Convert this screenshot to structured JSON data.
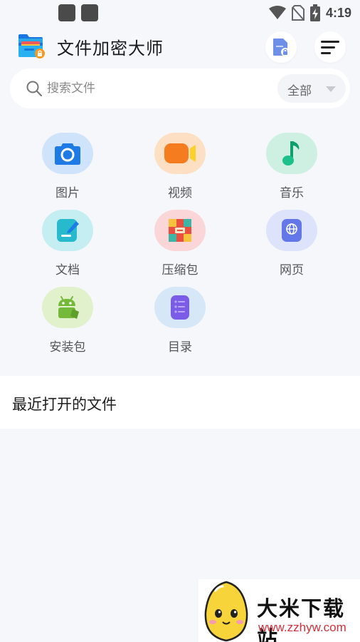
{
  "status_bar": {
    "time": "4:19",
    "icons": [
      "app-notification-icon",
      "app-notification-icon",
      "wifi-icon",
      "no-sim-icon",
      "battery-charging-icon"
    ]
  },
  "header": {
    "title": "文件加密大师",
    "logo_icon": "folder-lock-icon",
    "actions": [
      "lock-file-icon",
      "menu-icon"
    ]
  },
  "search": {
    "placeholder": "搜索文件",
    "filter_label": "全部"
  },
  "categories": [
    {
      "label": "图片",
      "icon": "camera-icon",
      "bg": "#cfe3fb",
      "accent": "#1e7be6"
    },
    {
      "label": "视频",
      "icon": "video-icon",
      "bg": "#fde0c4",
      "accent": "#f57c1f"
    },
    {
      "label": "音乐",
      "icon": "music-note-icon",
      "bg": "#cdf0e2",
      "accent": "#1cc08a"
    },
    {
      "label": "文档",
      "icon": "document-icon",
      "bg": "#c4eef2",
      "accent": "#27b9cc"
    },
    {
      "label": "压缩包",
      "icon": "archive-icon",
      "bg": "#fbd6d8",
      "accent": "#e9503f"
    },
    {
      "label": "网页",
      "icon": "web-icon",
      "bg": "#dde3fb",
      "accent": "#6477e8"
    },
    {
      "label": "安装包",
      "icon": "android-icon",
      "bg": "#e0f1cc",
      "accent": "#75b93b"
    },
    {
      "label": "目录",
      "icon": "directory-icon",
      "bg": "#d6e7f8",
      "accent": "#7a5ce6"
    }
  ],
  "recent": {
    "title": "最近打开的文件"
  },
  "watermark": {
    "title": "大米下载站",
    "url": "www.zzhyw.com"
  },
  "colors": {
    "background": "#f6f7fb",
    "surface": "#ffffff",
    "watermark_url": "#d4303a"
  }
}
